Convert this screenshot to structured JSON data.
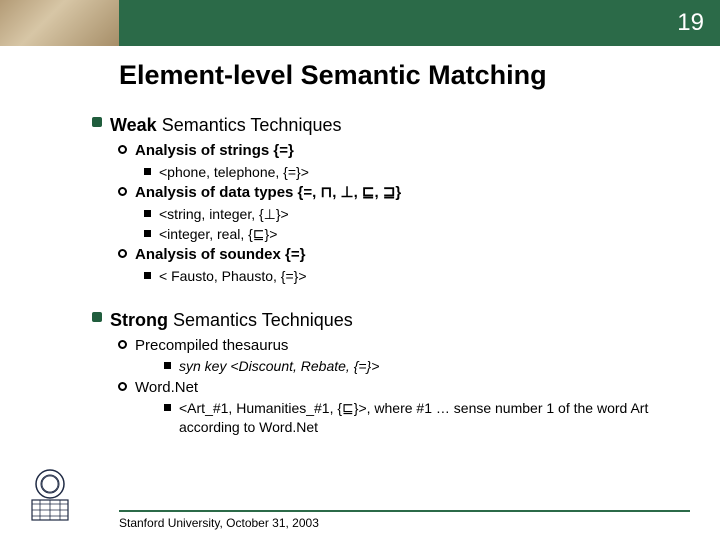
{
  "page_number": "19",
  "title": "Element-level Semantic Matching",
  "sections": [
    {
      "heading_bold": "Weak",
      "heading_rest": " Semantics Techniques",
      "items": [
        {
          "label": "Analysis of strings {=}",
          "examples": [
            "<phone, telephone, {=}>"
          ]
        },
        {
          "label": "Analysis of data types {=, ⊓, ⊥, ⊑, ⊒}",
          "examples": [
            "<string, integer, {⊥}>",
            "<integer, real, {⊑}>"
          ]
        },
        {
          "label": "Analysis of soundex {=}",
          "examples": [
            "< Fausto, Phausto, {=}>"
          ]
        }
      ]
    },
    {
      "heading_bold": "Strong",
      "heading_rest": " Semantics Techniques",
      "items": [
        {
          "label": "Precompiled thesaurus",
          "sub_italic": [
            "syn key <Discount, Rebate, {=}>"
          ]
        },
        {
          "label": "Word.Net",
          "sub_plain": [
            "<Art_#1, Humanities_#1, {⊑}>, where #1 … sense number 1 of the word Art according to Word.Net"
          ]
        }
      ]
    }
  ],
  "footer": "Stanford University, October 31, 2003"
}
